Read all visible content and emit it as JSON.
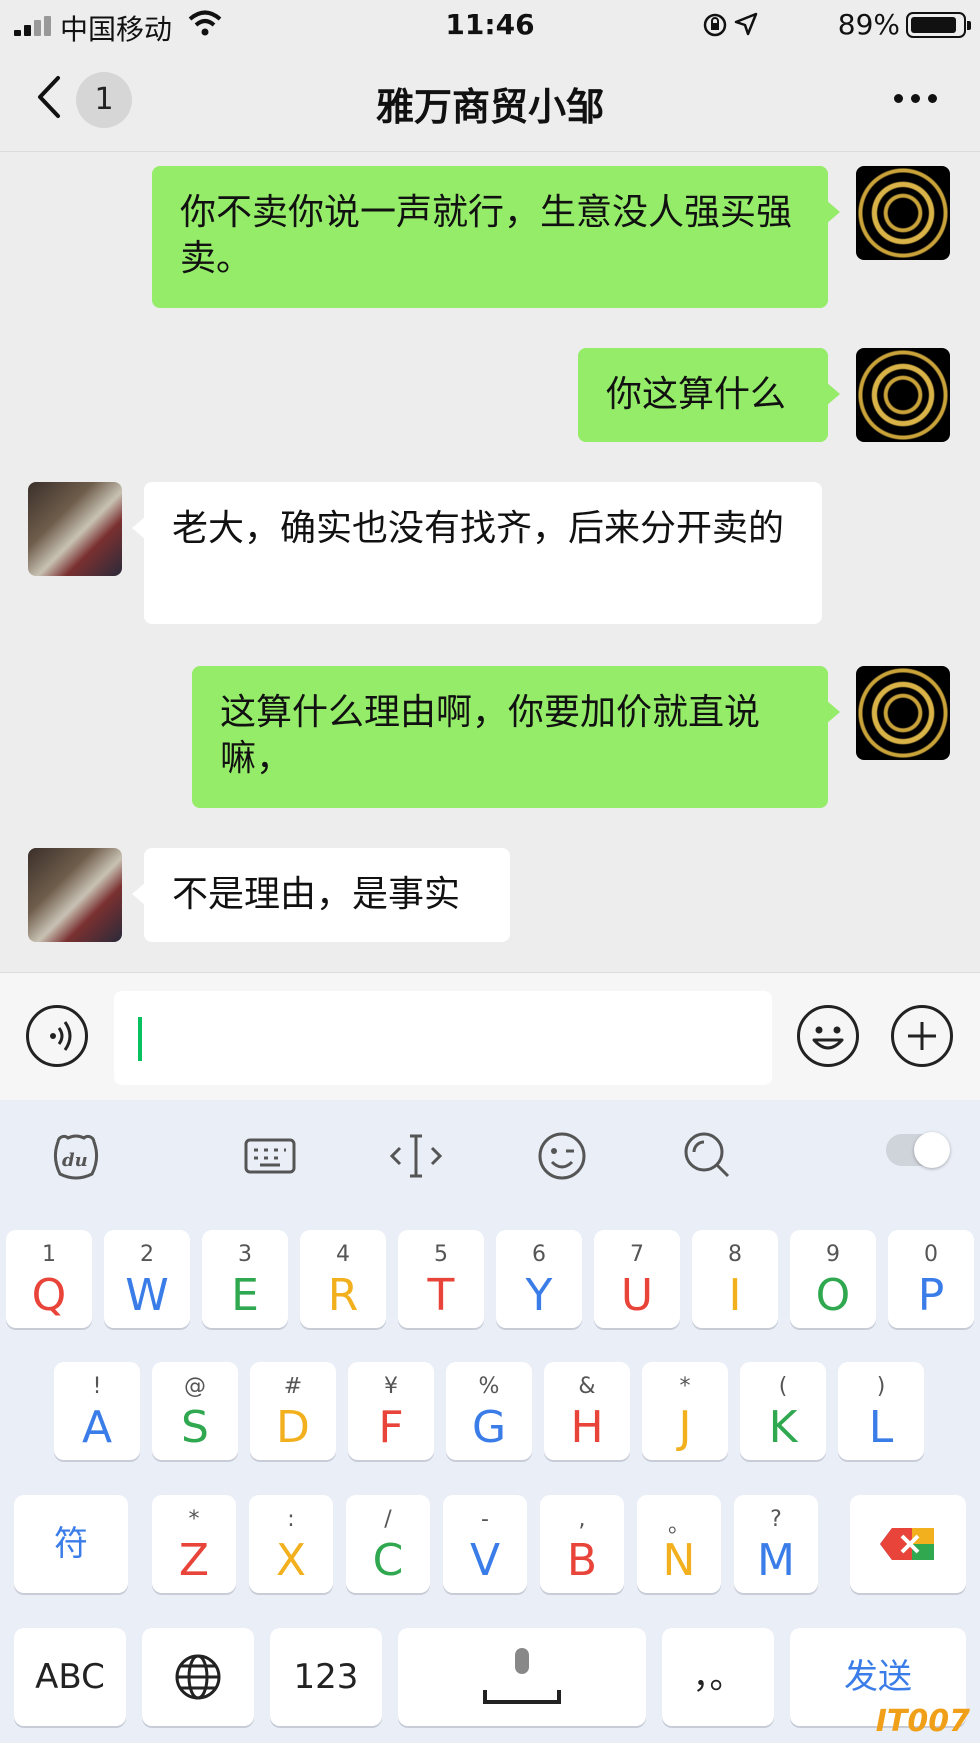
{
  "status_bar": {
    "carrier": "中国移动",
    "time": "11:46",
    "battery_percent": "89%",
    "battery_level": 0.89
  },
  "nav": {
    "unread_count": "1",
    "title": "雅万商贸小邹"
  },
  "messages": [
    {
      "from": "me",
      "text": "你不卖你说一声就行，生意没人强买强卖。"
    },
    {
      "from": "me",
      "text": "你这算什么"
    },
    {
      "from": "other",
      "text": "老大，确实也没有找齐，后来分开卖的"
    },
    {
      "from": "me",
      "text": "这算什么理由啊，你要加价就直说嘛，"
    },
    {
      "from": "other",
      "text": "不是理由，是事实"
    }
  ],
  "keyboard": {
    "row1": [
      {
        "sub": "1",
        "key": "Q",
        "color": "#e8443a"
      },
      {
        "sub": "2",
        "key": "W",
        "color": "#3b7de8"
      },
      {
        "sub": "3",
        "key": "E",
        "color": "#2fa84f"
      },
      {
        "sub": "4",
        "key": "R",
        "color": "#f2b01e"
      },
      {
        "sub": "5",
        "key": "T",
        "color": "#e8443a"
      },
      {
        "sub": "6",
        "key": "Y",
        "color": "#3b7de8"
      },
      {
        "sub": "7",
        "key": "U",
        "color": "#e8443a"
      },
      {
        "sub": "8",
        "key": "I",
        "color": "#f2b01e"
      },
      {
        "sub": "9",
        "key": "O",
        "color": "#2fa84f"
      },
      {
        "sub": "0",
        "key": "P",
        "color": "#3b7de8"
      }
    ],
    "row2": [
      {
        "sub": "!",
        "key": "A",
        "color": "#3b7de8"
      },
      {
        "sub": "@",
        "key": "S",
        "color": "#2fa84f"
      },
      {
        "sub": "#",
        "key": "D",
        "color": "#f2b01e"
      },
      {
        "sub": "¥",
        "key": "F",
        "color": "#e8443a"
      },
      {
        "sub": "%",
        "key": "G",
        "color": "#3b7de8"
      },
      {
        "sub": "&",
        "key": "H",
        "color": "#e8443a"
      },
      {
        "sub": "*",
        "key": "J",
        "color": "#f2b01e"
      },
      {
        "sub": "(",
        "key": "K",
        "color": "#2fa84f"
      },
      {
        "sub": ")",
        "key": "L",
        "color": "#3b7de8"
      }
    ],
    "row3": [
      {
        "sub": "*",
        "key": "Z",
        "color": "#e8443a"
      },
      {
        "sub": ":",
        "key": "X",
        "color": "#f2b01e"
      },
      {
        "sub": "/",
        "key": "C",
        "color": "#2fa84f"
      },
      {
        "sub": "-",
        "key": "V",
        "color": "#3b7de8"
      },
      {
        "sub": ",",
        "key": "B",
        "color": "#e8443a"
      },
      {
        "sub": "。",
        "key": "N",
        "color": "#f2b01e"
      },
      {
        "sub": "?",
        "key": "M",
        "color": "#3b7de8"
      }
    ],
    "symbols_label": "符",
    "abc_label": "ABC",
    "num_label": "123",
    "punct_label": "，。",
    "send_label": "发送"
  },
  "watermark": "IT007"
}
